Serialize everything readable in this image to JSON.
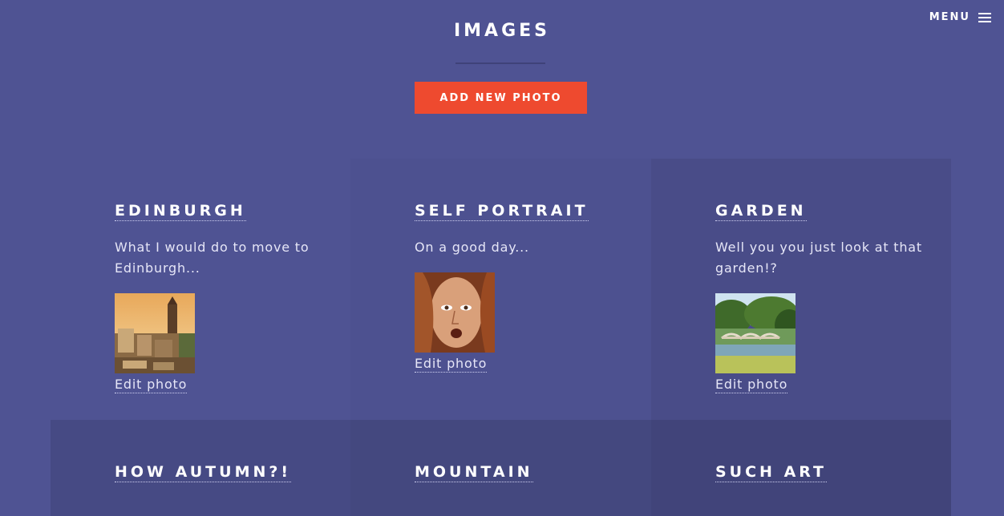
{
  "header": {
    "menu_label": "MENU",
    "menu_icon": "hamburger-icon",
    "title": "IMAGES",
    "add_button_label": "ADD NEW PHOTO"
  },
  "colors": {
    "background": "#4f5393",
    "accent_button": "#ee4a2f"
  },
  "cards": [
    {
      "title": "EDINBURGH",
      "description": "What I would do to move to Edinburgh...",
      "image": "edinburgh-photo",
      "edit_label": "Edit photo"
    },
    {
      "title": "SELF PORTRAIT",
      "description": "On a good day...",
      "image": "self-portrait-photo",
      "edit_label": "Edit photo"
    },
    {
      "title": "GARDEN",
      "description": "Well you you just look at that garden!?",
      "image": "garden-photo",
      "edit_label": "Edit photo"
    },
    {
      "title": "HOW AUTUMN?!"
    },
    {
      "title": "MOUNTAIN"
    },
    {
      "title": "SUCH ART"
    }
  ]
}
